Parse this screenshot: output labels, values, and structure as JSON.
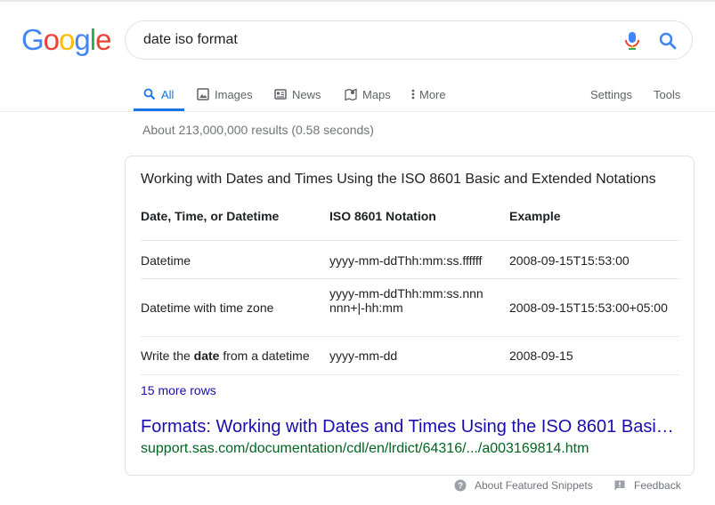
{
  "logo": {
    "letters": [
      "G",
      "o",
      "o",
      "g",
      "l",
      "e"
    ],
    "colors": [
      "#4285f4",
      "#ea4335",
      "#fbbc05",
      "#4285f4",
      "#34a853",
      "#ea4335"
    ]
  },
  "search": {
    "query": "date iso format",
    "mic_icon": "microphone-icon",
    "search_icon": "search-icon"
  },
  "tabs": {
    "all": "All",
    "images": "Images",
    "news": "News",
    "maps": "Maps",
    "more": "More",
    "settings": "Settings",
    "tools": "Tools",
    "active": "All"
  },
  "result_stats": "About 213,000,000 results (0.58 seconds)",
  "snippet": {
    "title": "Working with Dates and Times Using the ISO 8601 Basic and Extended Notations",
    "headers": [
      "Date, Time, or Datetime",
      "ISO 8601 Notation",
      "Example"
    ],
    "rows": [
      [
        "Datetime",
        "yyyy-mm-ddThh:mm:ss.ffffff",
        "2008-09-15T15:53:00"
      ],
      [
        "Datetime with time zone",
        "yyyy-mm-ddThh:mm:ss.nnnnnn+|-hh:mm",
        "2008-09-15T15:53:00+05:00"
      ],
      [
        "Write the date from a datetime",
        "yyyy-mm-dd",
        "2008-09-15"
      ]
    ],
    "row3_prefix": "Write the ",
    "row3_bold": "date",
    "row3_suffix": " from a datetime",
    "more_rows": "15 more rows",
    "link_title": "Formats: Working with Dates and Times Using the ISO 8601 Basic ...",
    "url": "support.sas.com/documentation/cdl/en/lrdict/64316/.../a003169814.htm"
  },
  "footer": {
    "about": "About Featured Snippets",
    "feedback": "Feedback"
  },
  "colors": {
    "accent": "#1a73e8",
    "link": "#1a0dab",
    "url": "#006621"
  }
}
